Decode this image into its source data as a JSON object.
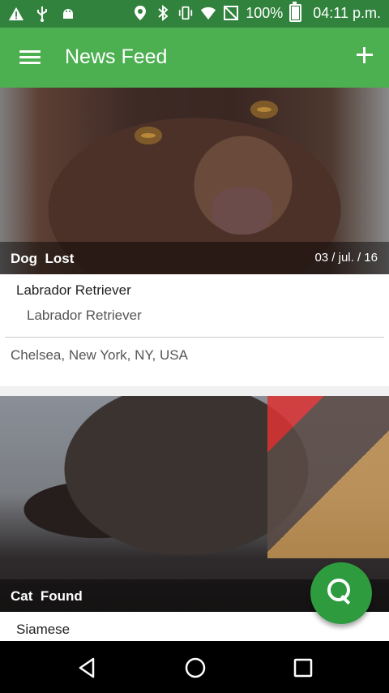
{
  "status_bar": {
    "battery": "100%",
    "time": "04:11 p.m.",
    "icons": [
      "warning-icon",
      "usb-icon",
      "android-icon",
      "location-icon",
      "bluetooth-icon",
      "vibrate-icon",
      "wifi-icon",
      "no-signal-icon",
      "battery-icon"
    ]
  },
  "appbar": {
    "title": "News Feed"
  },
  "cards": [
    {
      "category": "Dog",
      "status": "Lost",
      "date": "03 / jul. / 16",
      "breed": "Labrador Retriever",
      "sub_breed": "Labrador Retriever",
      "location": "Chelsea, New York, NY, USA"
    },
    {
      "category": "Cat",
      "status": "Found",
      "breed": "Siamese"
    }
  ],
  "colors": {
    "status_bar": "#30823c",
    "appbar": "#4caf50",
    "fab": "#2e9b3f"
  }
}
